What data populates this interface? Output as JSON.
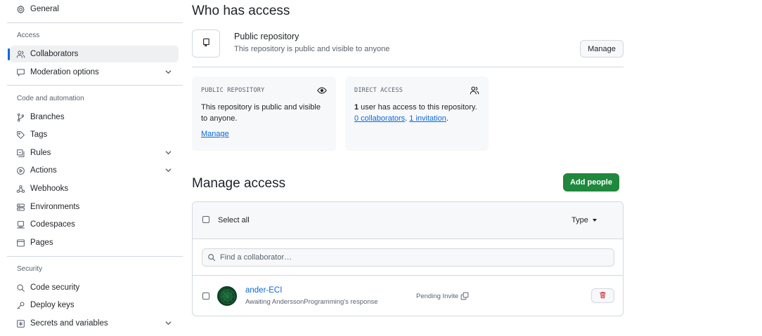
{
  "sidebar": {
    "general": "General",
    "access_heading": "Access",
    "collaborators": "Collaborators",
    "moderation": "Moderation options",
    "code_heading": "Code and automation",
    "branches": "Branches",
    "tags": "Tags",
    "rules": "Rules",
    "actions": "Actions",
    "webhooks": "Webhooks",
    "environments": "Environments",
    "codespaces": "Codespaces",
    "pages": "Pages",
    "security_heading": "Security",
    "code_security": "Code security",
    "deploy_keys": "Deploy keys",
    "secrets": "Secrets and variables"
  },
  "who_has_access": {
    "title": "Who has access",
    "repo_title": "Public repository",
    "repo_subtitle": "This repository is public and visible to anyone",
    "manage_button": "Manage"
  },
  "cards": {
    "public": {
      "heading": "PUBLIC REPOSITORY",
      "text": "This repository is public and visible to anyone.",
      "link": "Manage"
    },
    "direct": {
      "heading": "DIRECT ACCESS",
      "count": "1",
      "text_after_count": " user has access to this repository.",
      "collaborators_link": "0 collaborators",
      "sep": ". ",
      "invitation_link": "1 invitation",
      "end": "."
    }
  },
  "manage_access": {
    "title": "Manage access",
    "add_button": "Add people",
    "select_all": "Select all",
    "type_filter": "Type",
    "search_placeholder": "Find a collaborator…",
    "rows": [
      {
        "name": "ander-ECI",
        "subtitle": "Awaiting AnderssonProgramming's response",
        "status": "Pending Invite"
      }
    ]
  },
  "colors": {
    "accent": "#0969da",
    "primary_button": "#1f883d",
    "danger": "#cf222e"
  },
  "icons": [
    "gear-icon",
    "person-icon",
    "comment-icon",
    "git-branch-icon",
    "tag-icon",
    "rules-icon",
    "play-icon",
    "webhook-icon",
    "server-icon",
    "codespaces-icon",
    "browser-icon",
    "shield-icon",
    "key-icon",
    "asterisk-icon",
    "repo-icon",
    "eye-icon",
    "people-icon",
    "search-icon",
    "copy-icon",
    "trash-icon",
    "chevron-down-icon",
    "triangle-down-icon"
  ]
}
